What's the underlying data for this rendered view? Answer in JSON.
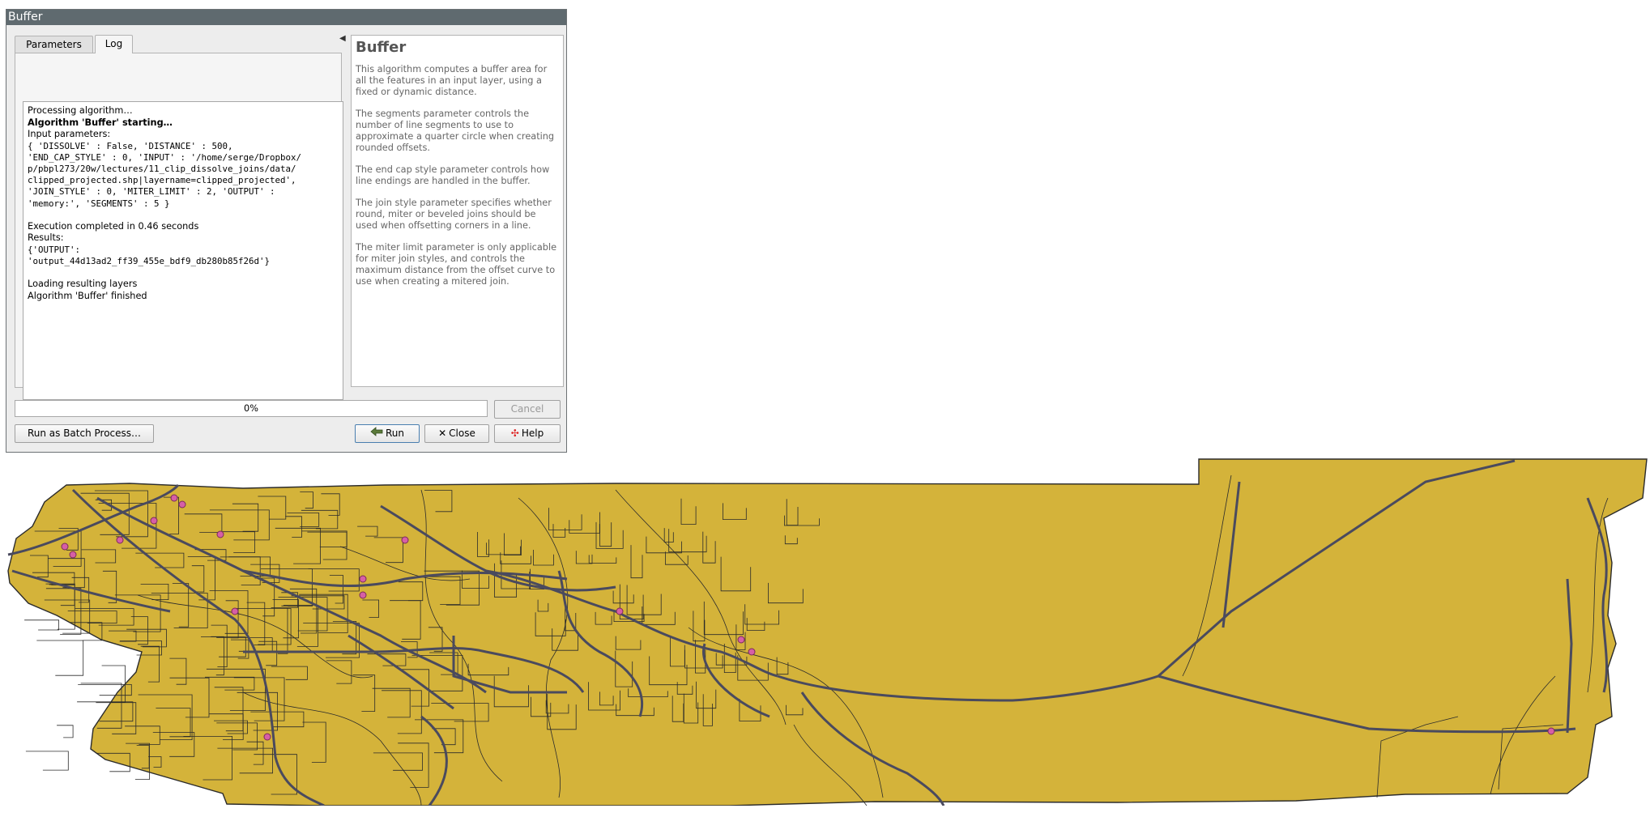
{
  "dialog": {
    "title": "Buffer",
    "tabs": [
      {
        "label": "Parameters"
      },
      {
        "label": "Log"
      }
    ],
    "log": {
      "line1": "Processing algorithm…",
      "line2": "Algorithm 'Buffer' starting…",
      "line3": "Input parameters:",
      "params": [
        "{ 'DISSOLVE' : False, 'DISTANCE' : 500,",
        "'END_CAP_STYLE' : 0, 'INPUT' : '/home/serge/Dropbox/",
        "p/pbpl273/20w/lectures/11_clip_dissolve_joins/data/",
        "clipped_projected.shp|layername=clipped_projected',",
        "'JOIN_STYLE' : 0, 'MITER_LIMIT' : 2, 'OUTPUT' :",
        "'memory:', 'SEGMENTS' : 5 }"
      ],
      "execution": "Execution completed in 0.46 seconds",
      "results": "Results:",
      "output_lines": [
        "{'OUTPUT':",
        "'output_44d13ad2_ff39_455e_bdf9_db280b85f26d'}"
      ],
      "loading": "Loading resulting layers",
      "finished": "Algorithm 'Buffer' finished"
    },
    "log_tools": [
      {
        "icon": "save-icon"
      },
      {
        "icon": "copy-icon"
      },
      {
        "icon": "clear-icon"
      }
    ],
    "help": {
      "title": "Buffer",
      "paragraphs": [
        "This algorithm computes a buffer area for all the features in an input layer, using a fixed or dynamic distance.",
        "The segments parameter controls the number of line segments to use to approximate a quarter circle when creating rounded offsets.",
        "The end cap style parameter controls how line endings are handled in the buffer.",
        "The join style parameter specifies whether round, miter or beveled joins should be used when offsetting corners in a line.",
        "The miter limit parameter is only applicable for miter join styles, and controls the maximum distance from the offset curve to use when creating a mitered join."
      ]
    },
    "progress": {
      "text": "0%",
      "value": 0
    },
    "buttons": {
      "cancel": "Cancel",
      "batch": "Run as Batch Process…",
      "run": "Run",
      "close": "Close",
      "help": "Help"
    }
  },
  "map": {
    "fill_color": "#d4b33a",
    "boundary_color": "#2b2b2b",
    "road_color": "#4a4a5e",
    "point_color": "#d65fa6"
  }
}
